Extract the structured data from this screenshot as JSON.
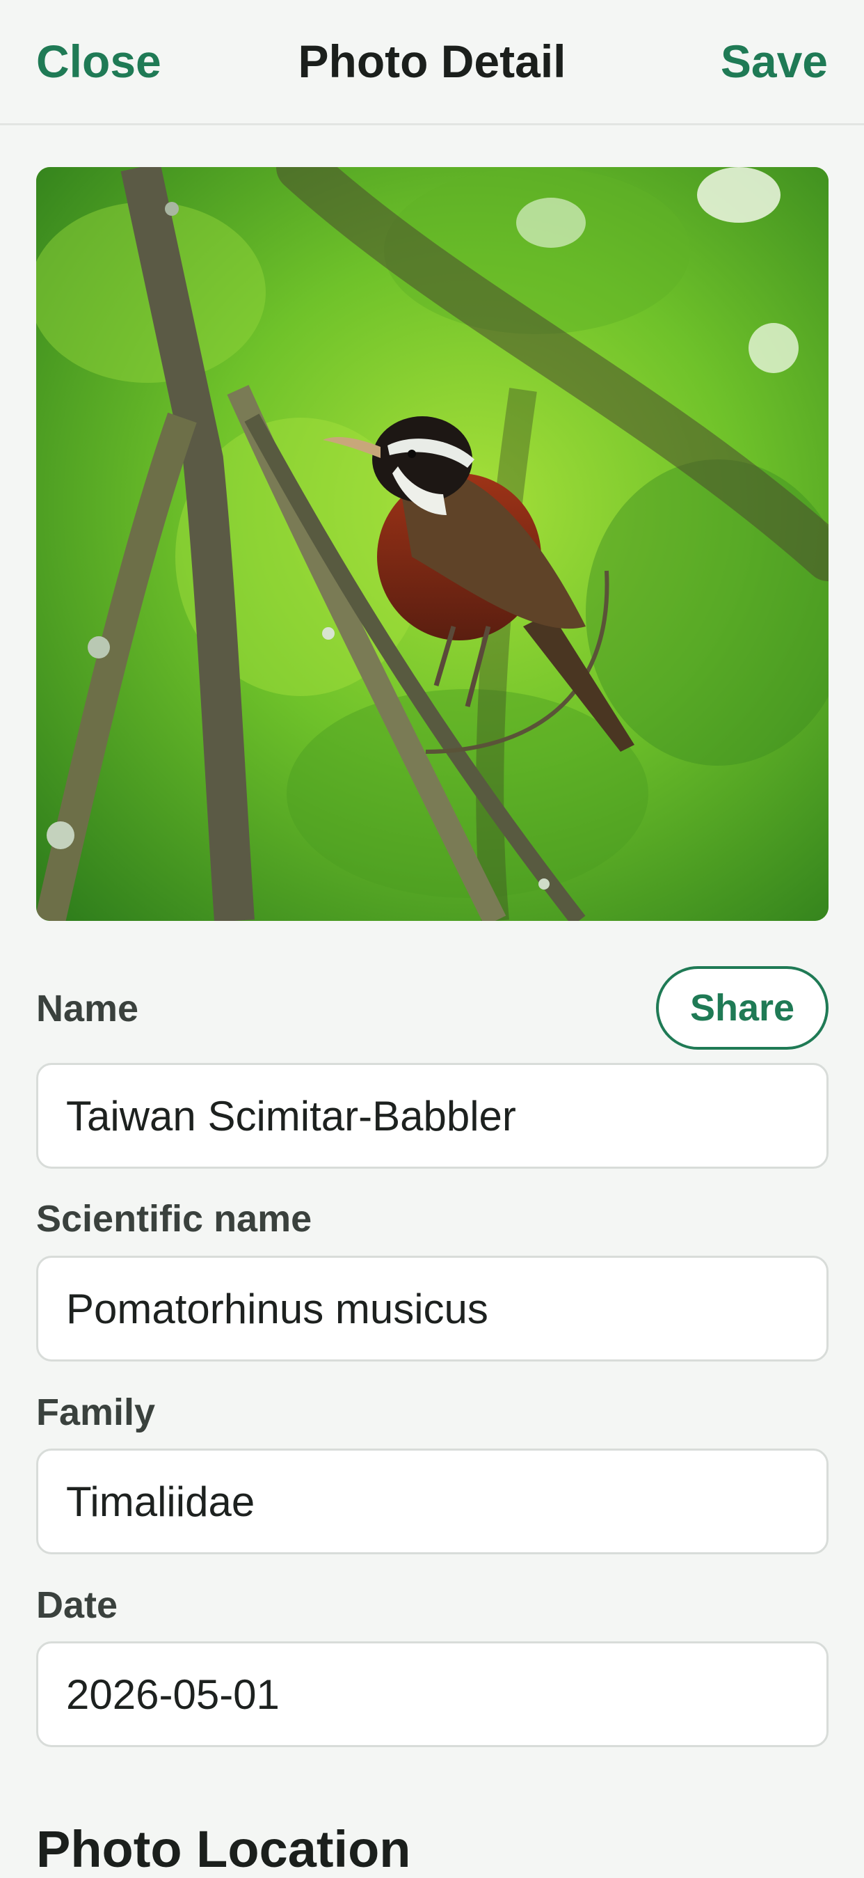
{
  "header": {
    "close_label": "Close",
    "title": "Photo Detail",
    "save_label": "Save"
  },
  "photo": {
    "subject": "Taiwan Scimitar-Babbler perched on branch"
  },
  "form": {
    "name_label": "Name",
    "share_label": "Share",
    "name_value": "Taiwan Scimitar-Babbler",
    "scientific_label": "Scientific name",
    "scientific_value": "Pomatorhinus musicus",
    "family_label": "Family",
    "family_value": "Timaliidae",
    "date_label": "Date",
    "date_value": "2026-05-01"
  },
  "section": {
    "location_title": "Photo Location"
  },
  "colors": {
    "accent": "#1f7a55",
    "background": "#f4f6f4",
    "field_border": "#d8dcd9"
  }
}
